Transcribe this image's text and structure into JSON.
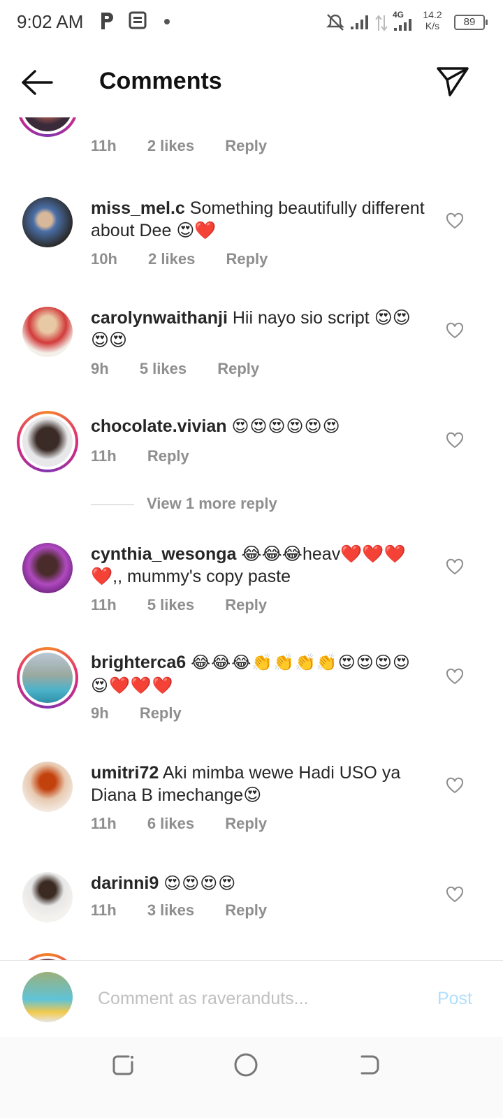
{
  "status_bar": {
    "time": "9:02 AM",
    "network": "4G",
    "speed_value": "14.2",
    "speed_unit": "K/s",
    "battery": "89"
  },
  "header": {
    "title": "Comments"
  },
  "comments": [
    {
      "username": "",
      "text": "❤️❤️",
      "time": "11h",
      "likes": "2 likes",
      "reply": "Reply"
    },
    {
      "username": "miss_mel.c",
      "text": "Something beautifully different about Dee 😍❤️",
      "time": "10h",
      "likes": "2 likes",
      "reply": "Reply"
    },
    {
      "username": "carolynwaithanji",
      "text": "Hii nayo sio script 😍😍😍😍",
      "time": "9h",
      "likes": "5 likes",
      "reply": "Reply"
    },
    {
      "username": "chocolate.vivian",
      "text": "😍😍😍😍😍😍",
      "time": "11h",
      "likes": "",
      "reply": "Reply"
    },
    {
      "username": "cynthia_wesonga",
      "text": "😂😂😂heav❤️❤️❤️❤️,, mummy's copy paste",
      "time": "11h",
      "likes": "5 likes",
      "reply": "Reply"
    },
    {
      "username": "brighterca6",
      "text": "😂😂😂👏👏👏👏😍😍😍😍😍❤️❤️❤️",
      "time": "9h",
      "likes": "",
      "reply": "Reply"
    },
    {
      "username": "umitri72",
      "text": "Aki mimba wewe Hadi USO ya Diana B imechange😍",
      "time": "11h",
      "likes": "6 likes",
      "reply": "Reply"
    },
    {
      "username": "darinni9",
      "text": "😍😍😍😍",
      "time": "11h",
      "likes": "3 likes",
      "reply": "Reply"
    }
  ],
  "view_more_replies": "View 1 more reply",
  "composer": {
    "placeholder": "Comment as raveranduts...",
    "post_label": "Post"
  },
  "colors": {
    "text": "#262626",
    "meta": "#8e8e8e",
    "post_disabled": "#b2dffc",
    "story_ring_start": "#f58529",
    "story_ring_end": "#dd2a7b"
  }
}
